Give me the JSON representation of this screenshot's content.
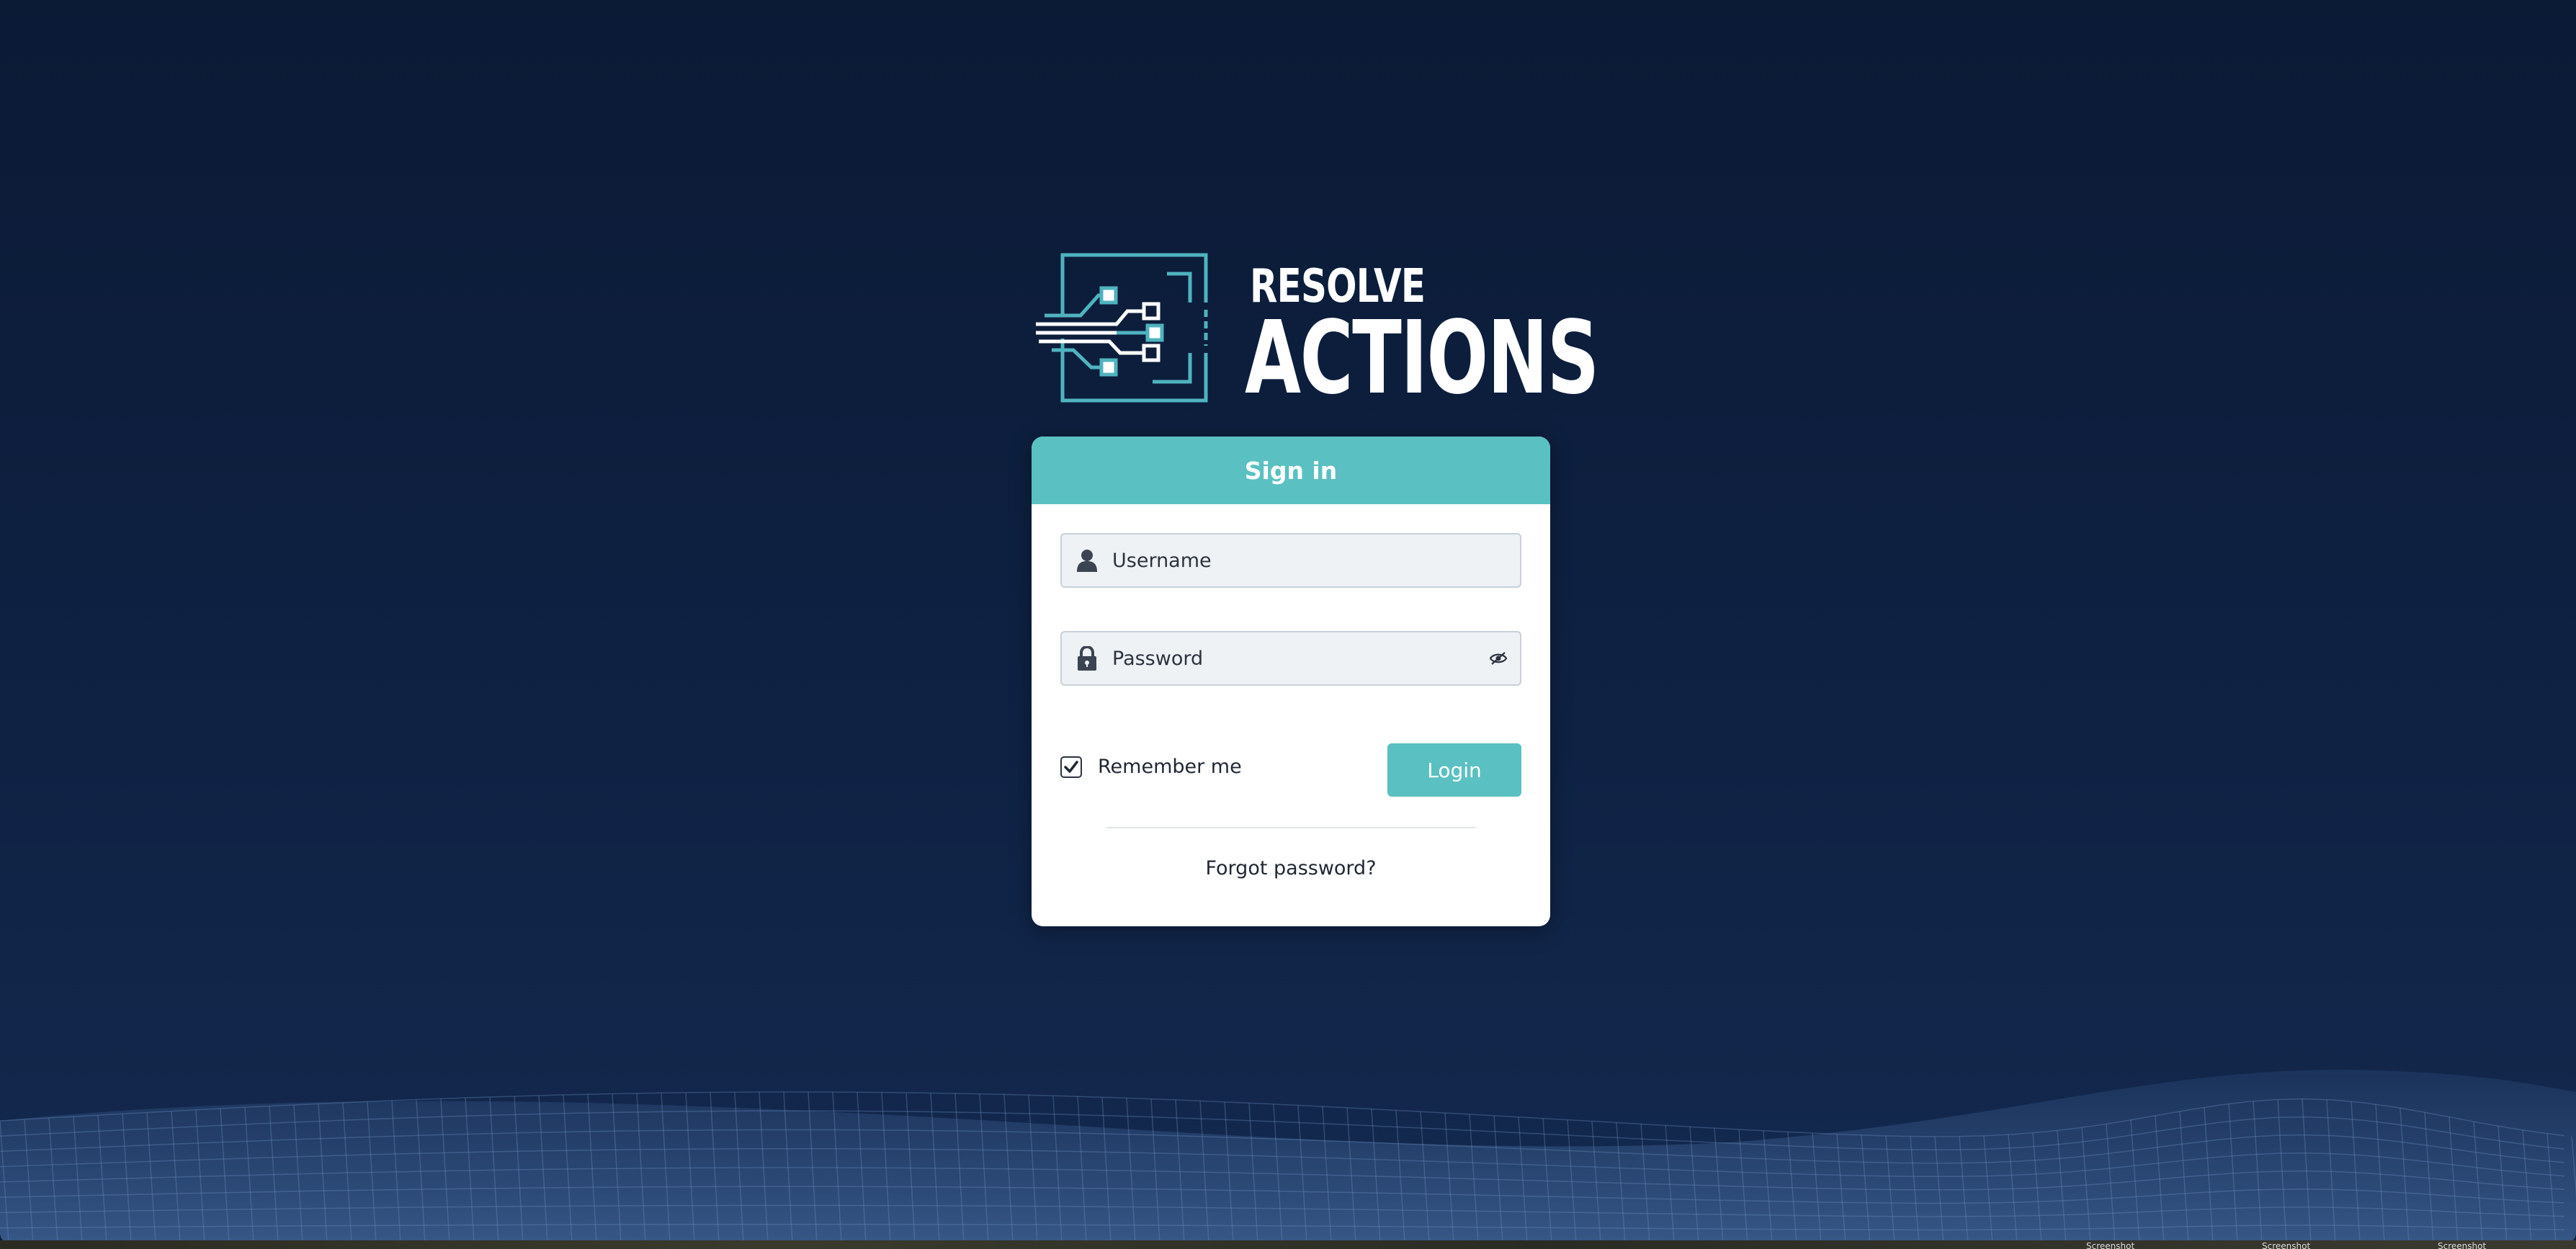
{
  "brand": {
    "line1": "RESOLVE",
    "line2": "ACTIONS",
    "logo_icon": "circuit-logo-icon"
  },
  "signin": {
    "title": "Sign in",
    "username_placeholder": "Username",
    "password_placeholder": "Password",
    "remember_label": "Remember me",
    "remember_checked": true,
    "login_label": "Login",
    "forgot_label": "Forgot password?"
  },
  "icons": {
    "user": "user-icon",
    "lock": "lock-icon",
    "toggle_visibility": "eye-slash-icon",
    "check": "check-icon"
  },
  "colors": {
    "accent": "#5bc0c1",
    "background": "#0f2244",
    "logo_teal": "#4fb3bf"
  },
  "dock": {
    "labels": [
      "Screenshot",
      "Screenshot",
      "Screenshot"
    ]
  }
}
